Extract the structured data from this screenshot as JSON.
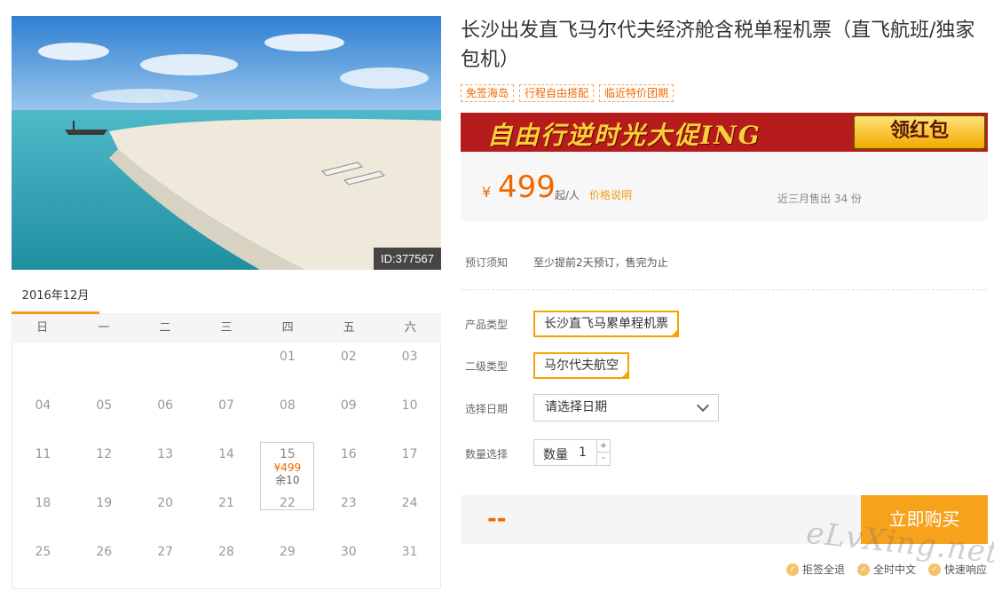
{
  "product": {
    "title": "长沙出发直飞马尔代夫经济舱含税单程机票（直飞航班/独家包机）",
    "id_badge": "ID:377567",
    "tags": [
      "免签海岛",
      "行程自由搭配",
      "临近特价团期"
    ]
  },
  "banner": {
    "text": "自由行逆时光大促ING",
    "button": "领红包"
  },
  "price": {
    "currency": "¥",
    "amount": "499",
    "unit": "起/人",
    "note": "价格说明",
    "sold": "近三月售出 34 份"
  },
  "booking": {
    "notice_label": "预订须知",
    "notice_text": "至少提前2天预订，售完为止",
    "product_type_label": "产品类型",
    "product_type_value": "长沙直飞马累单程机票",
    "sub_type_label": "二级类型",
    "sub_type_value": "马尔代夫航空",
    "date_label": "选择日期",
    "date_placeholder": "请选择日期",
    "qty_label": "数量选择",
    "qty_inner_label": "数量",
    "qty_value": "1",
    "plus": "+",
    "minus": "-"
  },
  "purchase": {
    "total": "--",
    "buy_button": "立即购买"
  },
  "guarantees": [
    "拒签全退",
    "全时中文",
    "快速响应"
  ],
  "watermark": "eLvXing.net",
  "calendar": {
    "month": "2016年12月",
    "weekdays": [
      "日",
      "一",
      "二",
      "三",
      "四",
      "五",
      "六"
    ],
    "rows": [
      [
        "",
        "",
        "",
        "",
        "01",
        "02",
        "03"
      ],
      [
        "04",
        "05",
        "06",
        "07",
        "08",
        "09",
        "10"
      ],
      [
        "11",
        "12",
        "13",
        "14",
        "15",
        "16",
        "17"
      ],
      [
        "18",
        "19",
        "20",
        "21",
        "22",
        "23",
        "24"
      ],
      [
        "25",
        "26",
        "27",
        "28",
        "29",
        "30",
        "31"
      ]
    ],
    "available": {
      "day": "15",
      "price": "¥499",
      "remain": "余10"
    }
  }
}
